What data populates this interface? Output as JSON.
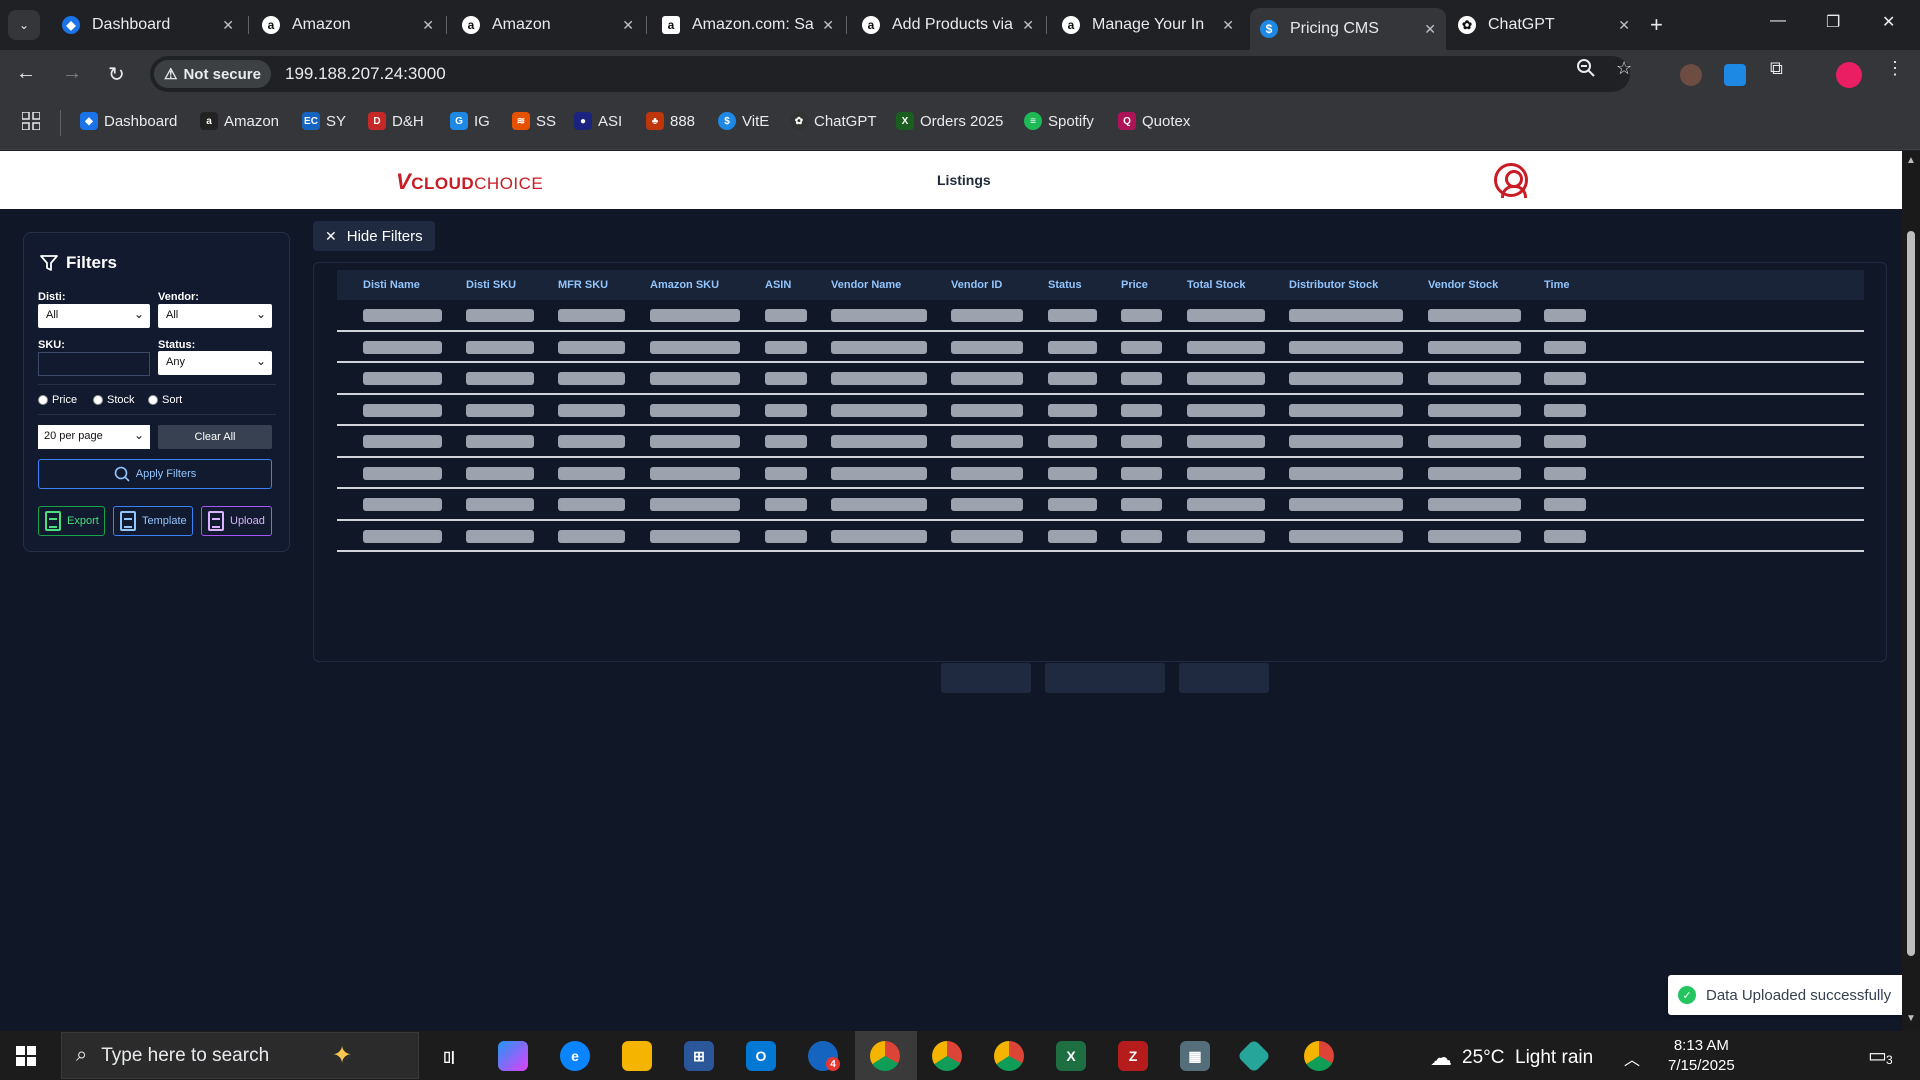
{
  "browser": {
    "tabs": [
      {
        "label": "Dashboard",
        "icon": "dashboard-favicon"
      },
      {
        "label": "Amazon",
        "icon": "amazon-favicon"
      },
      {
        "label": "Amazon",
        "icon": "amazon-favicon"
      },
      {
        "label": "Amazon.com: Sa",
        "icon": "amazon-favicon"
      },
      {
        "label": "Add Products via",
        "icon": "amazon-favicon"
      },
      {
        "label": "Manage Your In",
        "icon": "amazon-favicon"
      },
      {
        "label": "Pricing CMS",
        "icon": "dollar-favicon",
        "active": true
      },
      {
        "label": "ChatGPT",
        "icon": "chatgpt-favicon"
      }
    ],
    "security_label": "Not secure",
    "url": "199.188.207.24:3000",
    "bookmarks": [
      {
        "label": "Dashboard",
        "color": "#1a73e8"
      },
      {
        "label": "Amazon",
        "color": "#222222"
      },
      {
        "label": "SY",
        "color": "#1565c0"
      },
      {
        "label": "D&H",
        "color": "#c62828"
      },
      {
        "label": "IG",
        "color": "#1e88e5"
      },
      {
        "label": "SS",
        "color": "#e65100"
      },
      {
        "label": "ASI",
        "color": "#1a237e"
      },
      {
        "label": "888",
        "color": "#bf360c"
      },
      {
        "label": "VitE",
        "color": "#1e88e5"
      },
      {
        "label": "ChatGPT",
        "color": "#333333"
      },
      {
        "label": "Orders 2025",
        "color": "#1b5e20"
      },
      {
        "label": "Spotify",
        "color": "#1db954"
      },
      {
        "label": "Quotex",
        "color": "#ad1457"
      }
    ]
  },
  "app": {
    "logo": {
      "v": "V",
      "text1": "CLOUD",
      "text2": "CHOICE"
    },
    "nav_listings": "Listings",
    "filters": {
      "title": "Filters",
      "disti_label": "Disti:",
      "disti_value": "All",
      "vendor_label": "Vendor:",
      "vendor_value": "All",
      "sku_label": "SKU:",
      "sku_value": "",
      "status_label": "Status:",
      "status_value": "Any",
      "sort_options": [
        "Price",
        "Stock",
        "Sort"
      ],
      "per_page": "20 per page",
      "clear_all": "Clear All",
      "apply": "Apply Filters",
      "export": "Export",
      "template": "Template",
      "upload": "Upload"
    },
    "hide_filters": "Hide Filters",
    "table": {
      "columns": [
        "Disti Name",
        "Disti SKU",
        "MFR SKU",
        "Amazon SKU",
        "ASIN",
        "Vendor Name",
        "Vendor ID",
        "Status",
        "Price",
        "Total Stock",
        "Distributor Stock",
        "Vendor Stock",
        "Time"
      ],
      "loading_rows": 8
    },
    "toast": "Data Uploaded successfully"
  },
  "taskbar": {
    "search_placeholder": "Type here to search",
    "weather": "25°C  Light rain",
    "time": "8:13 AM",
    "date": "7/15/2025",
    "notifications": "3",
    "outlook_badge": "4"
  }
}
